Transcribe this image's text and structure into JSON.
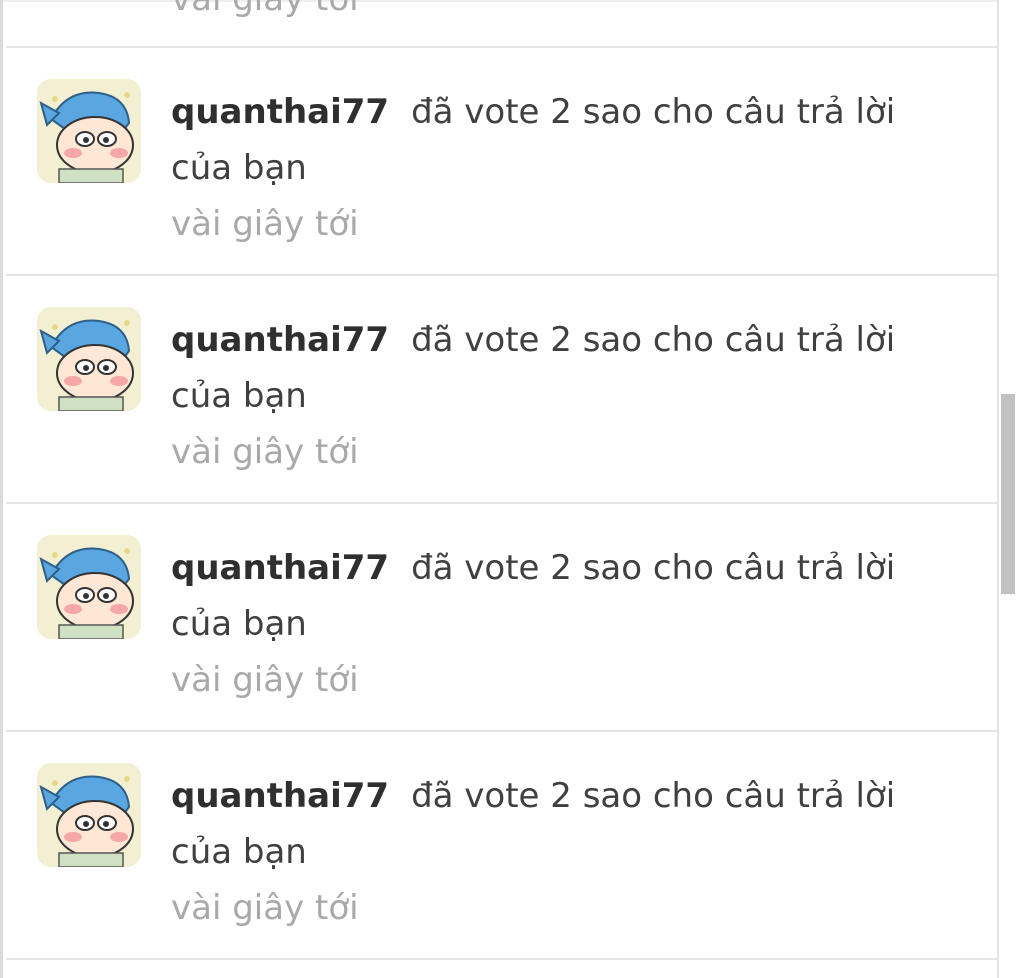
{
  "partial_item": {
    "time": "vài giây tới"
  },
  "notifications": [
    {
      "username": "quanthai77",
      "action": "đã vote 2 sao cho câu trả lời của bạn",
      "time": "vài giây tới",
      "avatar_icon": "cartoon-boy-avatar-icon"
    },
    {
      "username": "quanthai77",
      "action": "đã vote 2 sao cho câu trả lời của bạn",
      "time": "vài giây tới",
      "avatar_icon": "cartoon-boy-avatar-icon"
    },
    {
      "username": "quanthai77",
      "action": "đã vote 2 sao cho câu trả lời của bạn",
      "time": "vài giây tới",
      "avatar_icon": "cartoon-boy-avatar-icon"
    },
    {
      "username": "quanthai77",
      "action": "đã vote 2 sao cho câu trả lời của bạn",
      "time": "vài giây tới",
      "avatar_icon": "cartoon-boy-avatar-icon"
    }
  ],
  "colors": {
    "username": "#2f2f2f",
    "message": "#404040",
    "time": "#a9a9a9",
    "divider": "#e6e6e6",
    "scrollbar_thumb": "#c1c1c1"
  }
}
